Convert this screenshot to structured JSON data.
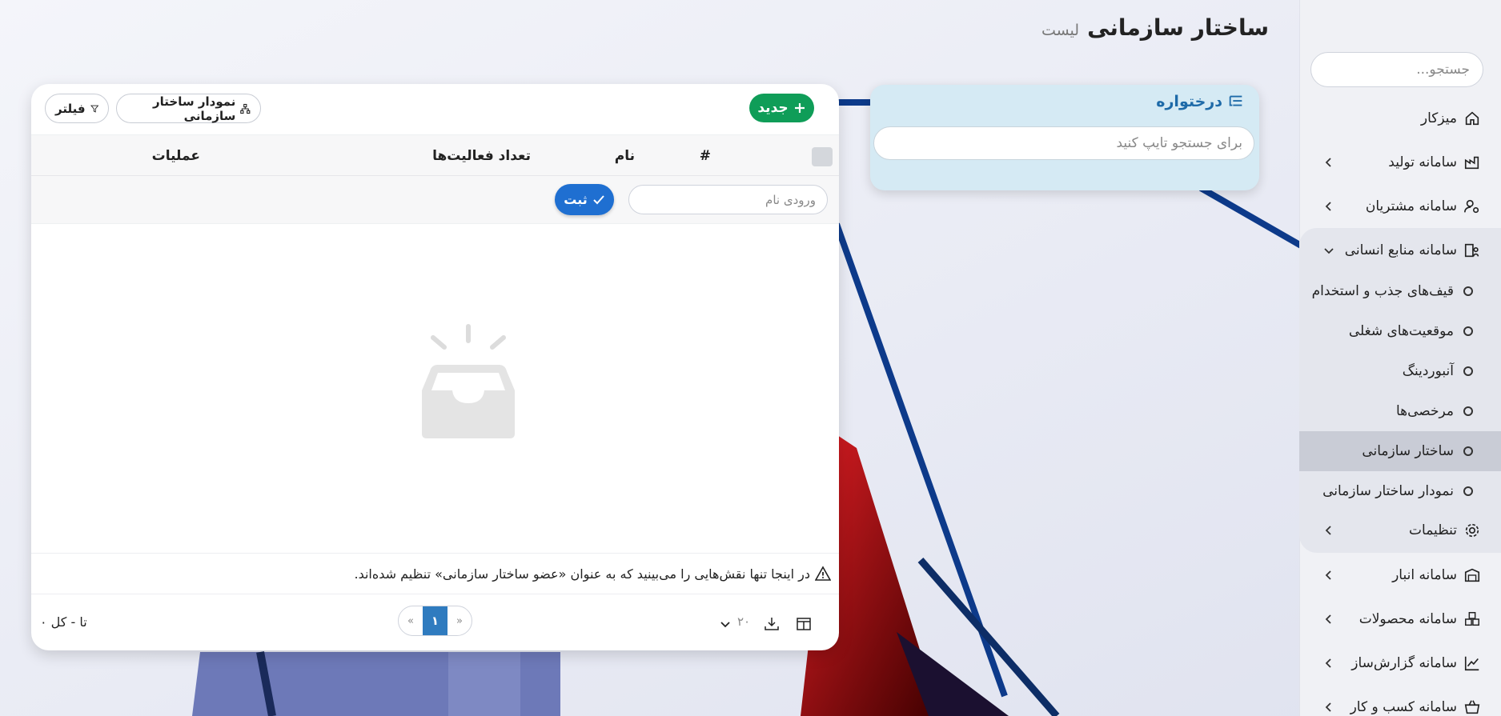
{
  "page": {
    "title": "ساختار سازمانی",
    "subtitle": "لیست"
  },
  "sidebar": {
    "search_placeholder": "جستجو...",
    "items": [
      {
        "label": "میزکار",
        "icon": "home-icon"
      },
      {
        "label": "سامانه تولید",
        "icon": "factory-icon"
      },
      {
        "label": "سامانه مشتریان",
        "icon": "user-gear-icon"
      },
      {
        "label": "سامانه منابع انسانی",
        "icon": "building-people-icon"
      },
      {
        "label": "تنظیمات",
        "icon": "gear-icon"
      },
      {
        "label": "سامانه انبار",
        "icon": "warehouse-icon"
      },
      {
        "label": "سامانه محصولات",
        "icon": "boxes-icon"
      },
      {
        "label": "سامانه گزارش‌ساز",
        "icon": "chart-line-icon"
      },
      {
        "label": "سامانه کسب و کار",
        "icon": "basket-icon"
      }
    ],
    "submenu": [
      {
        "label": "قیف‌های جذب و استخدام"
      },
      {
        "label": "موقعیت‌های شغلی"
      },
      {
        "label": "آنبوردینگ"
      },
      {
        "label": "مرخصی‌ها"
      },
      {
        "label": "ساختار سازمانی"
      },
      {
        "label": "نمودار ساختار سازمانی"
      }
    ]
  },
  "tree": {
    "title": "درختواره",
    "search_placeholder": "برای جستجو تایپ کنید"
  },
  "toolbar": {
    "new_label": "جدید",
    "chart_label": "نمودار ساختار سازمانی",
    "filter_label": "فیلتر"
  },
  "table": {
    "columns": {
      "index": "#",
      "name": "نام",
      "activities": "تعداد فعالیت‌ها",
      "actions": "عملیات"
    },
    "new_row": {
      "name_placeholder": "ورودی نام",
      "save_label": "ثبت"
    }
  },
  "note": "در اینجا تنها نقش‌هایی را می‌بینید که به عنوان «عضو ساختار سازمانی» تنظیم شده‌اند.",
  "footer": {
    "total": "تا - کل ۰",
    "page_current": "۱",
    "prev": "«",
    "next": "»",
    "page_size": "۲۰"
  },
  "colors": {
    "primary": "#1f6fd1",
    "success": "#0f9d58",
    "tree_bg": "#d5eaf4",
    "pager_active": "#2f7bbf"
  }
}
